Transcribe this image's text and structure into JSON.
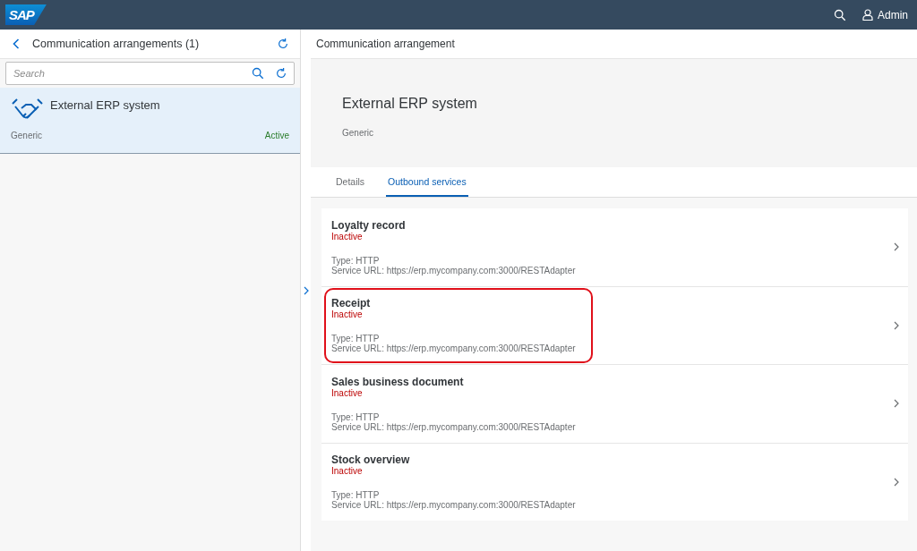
{
  "shell_bar": {
    "logo": "SAP",
    "user": "Admin"
  },
  "master": {
    "title": "Communication arrangements (1)",
    "search": {
      "placeholder": "Search"
    },
    "items": [
      {
        "title": "External ERP system",
        "subtitle": "Generic",
        "status": "Active",
        "active": true,
        "selected": true
      }
    ]
  },
  "detail": {
    "title": "Communication arrangement",
    "header_title": "External ERP system",
    "header_subtitle": "Generic",
    "tabs": [
      {
        "label": "Details",
        "selected": false
      },
      {
        "label": "Outbound services",
        "selected": true
      }
    ],
    "services": [
      {
        "title": "Loyalty record",
        "status": "Inactive",
        "active": false,
        "type": "Type: HTTP",
        "url": "Service URL: https://erp.mycompany.com:3000/RESTAdapter",
        "highlighted": false
      },
      {
        "title": "Receipt",
        "status": "Inactive",
        "active": false,
        "type": "Type: HTTP",
        "url": "Service URL: https://erp.mycompany.com:3000/RESTAdapter",
        "highlighted": true
      },
      {
        "title": "Sales business document",
        "status": "Inactive",
        "active": false,
        "type": "Type: HTTP",
        "url": "Service URL: https://erp.mycompany.com:3000/RESTAdapter",
        "highlighted": false
      },
      {
        "title": "Stock overview",
        "status": "Inactive",
        "active": false,
        "type": "Type: HTTP",
        "url": "Service URL: https://erp.mycompany.com:3000/RESTAdapter",
        "highlighted": false
      }
    ]
  }
}
